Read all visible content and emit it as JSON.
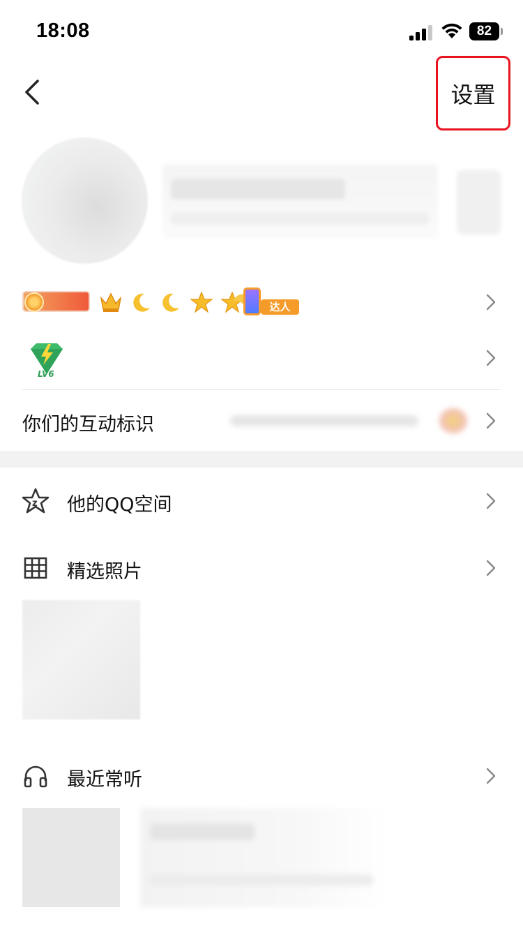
{
  "status_bar": {
    "time": "18:08",
    "battery": "82"
  },
  "nav": {
    "settings_label": "设置"
  },
  "profile_badges": {
    "talent_tag": "达人",
    "vip_level_text": "LV6"
  },
  "rows": {
    "interaction_label": "你们的互动标识"
  },
  "menu": {
    "qzone_label": "他的QQ空间",
    "photos_label": "精选照片",
    "music_label": "最近常听"
  },
  "colors": {
    "highlight_border": "#e8131f",
    "section_gap": "#f2f2f2",
    "divider": "#e6e6e6"
  },
  "icons": {
    "back": "chevron-left-icon",
    "row_arrow": "chevron-right-icon",
    "qzone": "qzone-star-icon",
    "photos": "grid-icon",
    "music": "headphones-icon"
  }
}
